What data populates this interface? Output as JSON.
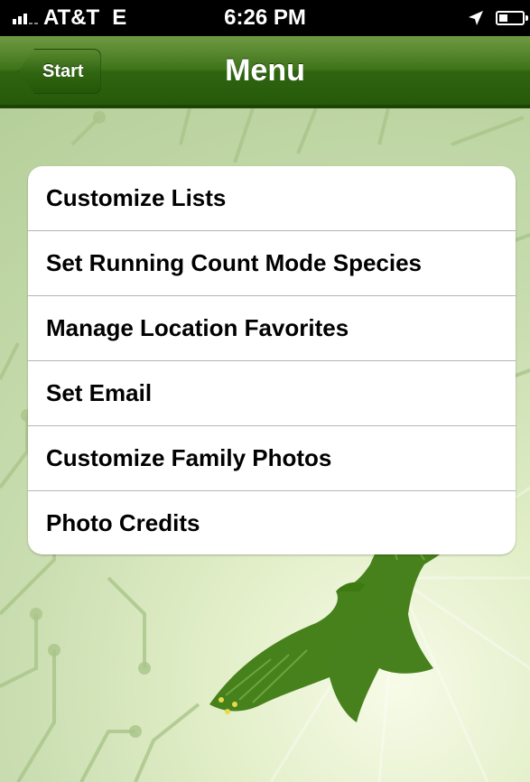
{
  "status_bar": {
    "carrier": "AT&T",
    "network": "E",
    "time": "6:26 PM"
  },
  "nav": {
    "back_label": "Start",
    "title": "Menu"
  },
  "menu": {
    "items": [
      {
        "label": "Customize Lists"
      },
      {
        "label": "Set Running Count Mode Species"
      },
      {
        "label": "Manage Location Favorites"
      },
      {
        "label": "Set Email"
      },
      {
        "label": "Customize Family Photos"
      },
      {
        "label": "Photo Credits"
      }
    ]
  },
  "icons": {
    "signal": "signal-icon",
    "location": "location-arrow-icon",
    "battery": "battery-icon",
    "background": "hawk-circuit-illustration"
  },
  "colors": {
    "nav_green": "#3f7419",
    "background_green": "#c9ddb0"
  }
}
